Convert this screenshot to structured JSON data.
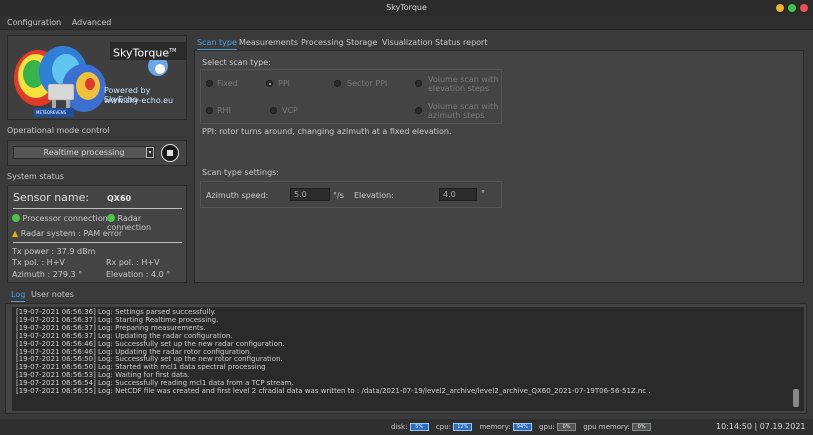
{
  "window": {
    "title": "SkyTorque"
  },
  "menu": {
    "items": [
      "Configuration",
      "Advanced"
    ]
  },
  "logo": {
    "brand": "SkyTorque",
    "tm": "TM",
    "powered": "Powered by SkyEcho",
    "url": "www.sky-echo.eu",
    "badge": "METEOREVENS"
  },
  "opmode": {
    "title": "Operational mode control",
    "selected": "Realtime processing"
  },
  "status": {
    "title": "System status",
    "sensor_label": "Sensor name:",
    "sensor_value": "QX60",
    "processor_conn": "Processor connection",
    "radar_conn": "Radar connection",
    "radar_system": "Radar system : PAM error",
    "tx_power": "Tx power : 37.9 dBm",
    "tx_pol": "Tx pol. : H+V",
    "rx_pol": "Rx pol. : H+V",
    "azimuth": "Azimuth : 279.3 °",
    "elevation": "Elevation : 4.0 °"
  },
  "tabs": [
    "Scan type",
    "Measurements",
    "Processing",
    "Storage",
    "Visualization",
    "Status report"
  ],
  "scan": {
    "select_label": "Select scan type:",
    "options": {
      "fixed": "Fixed",
      "ppi": "PPI",
      "sector": "Sector PPI",
      "vol_elev_1": "Volume scan with",
      "vol_elev_2": "elevation steps",
      "rhi": "RHI",
      "vcp": "VCP",
      "vol_az_1": "Volume scan with",
      "vol_az_2": "azimuth steps"
    },
    "description": "PPI: rotor turns around, changing azimuth at a fixed elevation.",
    "settings_label": "Scan type settings:",
    "az_speed_label": "Azimuth speed:",
    "az_speed_value": "5.0",
    "az_speed_unit": "°/s",
    "elevation_label": "Elevation:",
    "elevation_value": "4.0",
    "elevation_unit": "°"
  },
  "logtabs": [
    "Log",
    "User notes"
  ],
  "log_lines": [
    "[19-07-2021 06:56:36] Log: Settings parsed successfully.",
    "[19-07-2021 06:56:37] Log: Starting Realtime processing.",
    "[19-07-2021 06:56:37] Log: Preparing measurements.",
    "[19-07-2021 06:56:37] Log: Updating the radar configuration.",
    "[19-07-2021 06:56:46] Log: Successfully set up the new radar configuration.",
    "[19-07-2021 06:56:46] Log: Updating the radar rotor configuration.",
    "[19-07-2021 06:56:50] Log: Successfully set up the new rotor configuration.",
    "[19-07-2021 06:56:50] Log: Started with mcl1 data spectral processing",
    "[19-07-2021 06:56:53] Log: Waiting for first data.",
    "[19-07-2021 06:56:54] Log: Successfully reading mcl1 data from a TCP stream.",
    "[19-07-2021 06:56:55] Log: NetCDF file was created and first level 2 cfradial data was written to : /data/2021-07-19/level2_archive/level2_archive_QX60_2021-07-19T06-56-51Z.nc ."
  ],
  "statusbar": {
    "disk_label": "disk:",
    "disk_value": "5%",
    "cpu_label": "cpu:",
    "cpu_value": "12%",
    "memory_label": "memory:",
    "memory_value": "94%",
    "gpu_label": "gpu:",
    "gpu_value": "0%",
    "gpumem_label": "gpu memory:",
    "gpumem_value": "0%",
    "datetime": "10:14:50 | 07.19.2021"
  },
  "colors": {
    "accent": "#4aa3e0",
    "ok": "#4cc24c",
    "warning": "#e8b400",
    "close": "#e95149",
    "minimize": "#f0b12b",
    "maximize": "#3fc34a"
  }
}
